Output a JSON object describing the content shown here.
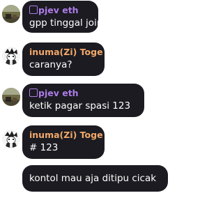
{
  "messages": [
    {
      "author": "pjev eth",
      "text": "gpp tinggal join"
    },
    {
      "author": "inuma(Zi) Toge",
      "text": "caranya?"
    },
    {
      "author": "pjev eth",
      "text": "ketik pagar spasi 123"
    },
    {
      "author": "inuma(Zi) Toge",
      "text": "# 123"
    },
    {
      "author": "",
      "text": "kontol mau aja ditipu cicak"
    }
  ],
  "avatars": {
    "pjev": "landscape-photo-avatar",
    "inuma": "anime-character-avatar"
  },
  "colors": {
    "bubble": "#1b1b21",
    "name_pjev": "#ae7ce8",
    "name_inuma": "#f2a86a",
    "text": "#ffffff"
  }
}
